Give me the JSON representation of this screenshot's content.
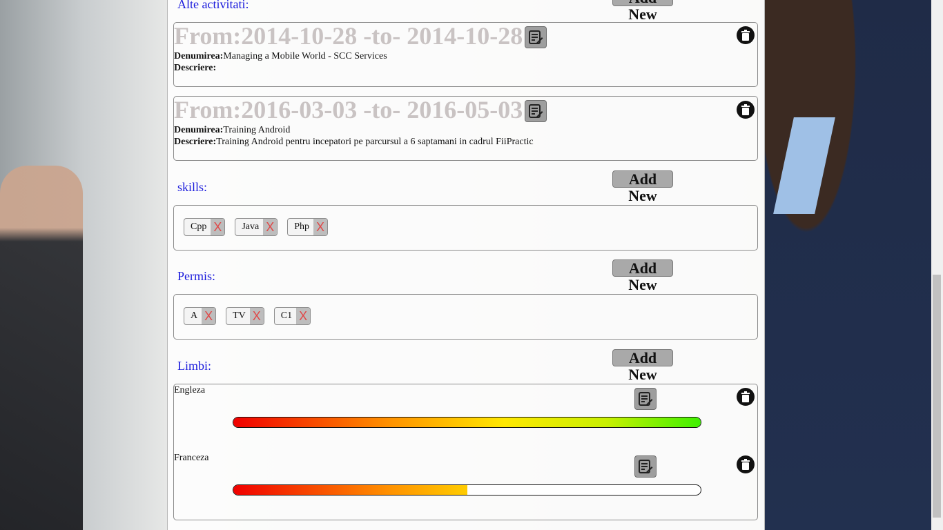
{
  "sections": {
    "alte": {
      "title": "Alte activitati:",
      "add_label": "Add New"
    },
    "skills": {
      "title": "skills:",
      "add_label": "Add New"
    },
    "permis": {
      "title": "Permis:",
      "add_label": "Add New"
    },
    "limbi": {
      "title": "Limbi:",
      "add_label": "Add New"
    }
  },
  "activities": [
    {
      "heading": "From:2014-10-28 -to- 2014-10-28",
      "denumire_label": "Denumirea:",
      "denumire": "Managing a Mobile World - SCC Services",
      "descriere_label": "Descriere:",
      "descriere": ""
    },
    {
      "heading": "From:2016-03-03 -to- 2016-05-03",
      "denumire_label": "Denumirea:",
      "denumire": "Training Android",
      "descriere_label": "Descriere:",
      "descriere": "Training Android pentru incepatori pe parcursul a 6 saptamani in cadrul FiiPractic"
    }
  ],
  "skills": [
    "Cpp",
    "Java",
    "Php"
  ],
  "permis": [
    "A",
    "TV",
    "C1"
  ],
  "remove_glyph": "X",
  "languages": [
    {
      "name": "Engleza",
      "level": 1.0
    },
    {
      "name": "Franceza",
      "level": 0.5
    }
  ],
  "icons": {
    "edit": "edit-document-icon",
    "delete": "trash-icon"
  },
  "colors": {
    "section_title": "#1a1adc",
    "button_bg": "#a9a9a9",
    "remove_x": "#e04848"
  }
}
